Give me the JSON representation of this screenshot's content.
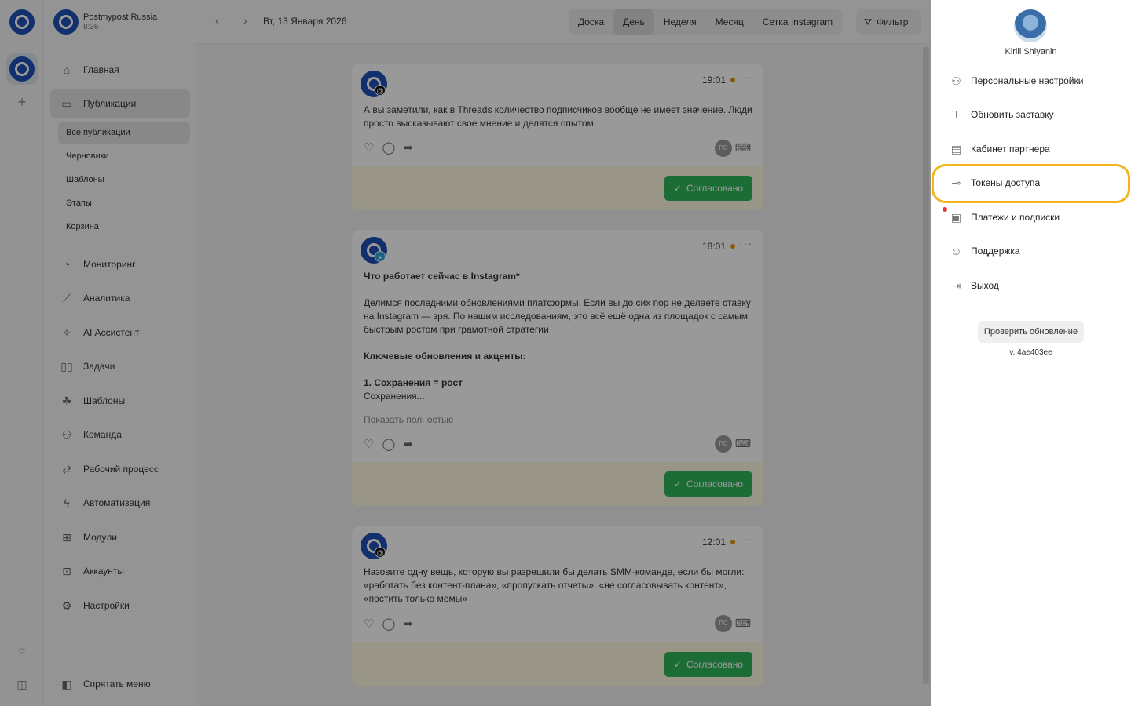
{
  "workspace": {
    "name": "Postmypost Russia",
    "time": "8:36"
  },
  "sidebar": {
    "items": [
      {
        "label": "Главная",
        "icon": "home-icon"
      },
      {
        "label": "Публикации",
        "icon": "publications-icon"
      },
      {
        "label": "Мониторинг",
        "icon": "monitoring-icon"
      },
      {
        "label": "Аналитика",
        "icon": "analytics-icon"
      },
      {
        "label": "AI Ассистент",
        "icon": "sparkles-icon"
      },
      {
        "label": "Задачи",
        "icon": "tasks-icon"
      },
      {
        "label": "Шаблоны",
        "icon": "templates-icon"
      },
      {
        "label": "Команда",
        "icon": "team-icon"
      },
      {
        "label": "Рабочий процесс",
        "icon": "workflow-icon"
      },
      {
        "label": "Автоматизация",
        "icon": "lightning-icon"
      },
      {
        "label": "Модули",
        "icon": "modules-icon"
      },
      {
        "label": "Аккаунты",
        "icon": "accounts-icon"
      },
      {
        "label": "Настройки",
        "icon": "gear-icon"
      }
    ],
    "subitems": [
      "Все публикации",
      "Черновики",
      "Шаблоны",
      "Этапы",
      "Корзина"
    ],
    "hide_menu": "Спрятать меню"
  },
  "topbar": {
    "date": "Вт, 13 Января 2026",
    "views": [
      "Доска",
      "День",
      "Неделя",
      "Месяц",
      "Сетка Instagram"
    ],
    "active_view": "День",
    "filter": "Фильтр"
  },
  "posts": [
    {
      "time": "19:01",
      "network": "threads",
      "text": "А вы заметили, как в Threads количество подписчиков вообще не имеет значение. Люди просто высказывают свое мнение и делятся опытом",
      "initials": "ПС",
      "status": "Согласовано"
    },
    {
      "time": "18:01",
      "network": "telegram",
      "heading": "Что работает сейчас в Instagram*",
      "paragraph": "Делимся последними обновлениями платформы. Если вы до сих пор не делаете ставку на Instagram — зря. По нашим исследованиям, это всё ещё одна из площадок с самым быстрым ростом при грамотной стратегии",
      "subheading": "Ключевые обновления и акценты:",
      "point": "1. Сохранения = рост",
      "tail": "Сохранения...",
      "show_more": "Показать полностью",
      "initials": "ПС",
      "status": "Согласовано"
    },
    {
      "time": "12:01",
      "network": "threads",
      "text": "Назовите одну вещь, которую вы разрешили бы делать SMM-команде, если бы могли: «работать без контент-плана», «пропускать отчеты», «не согласовывать контент», «постить только мемы»",
      "initials": "ПС",
      "status": "Согласовано"
    }
  ],
  "user_menu": {
    "user_name": "Kirill Shlyanin",
    "items": [
      {
        "label": "Персональные настройки",
        "icon": "user-icon"
      },
      {
        "label": "Обновить заставку",
        "icon": "paint-roller-icon"
      },
      {
        "label": "Кабинет партнера",
        "icon": "partner-icon"
      },
      {
        "label": "Токены доступа",
        "icon": "key-icon"
      },
      {
        "label": "Платежи и подписки",
        "icon": "receipt-icon"
      },
      {
        "label": "Поддержка",
        "icon": "chat-smile-icon"
      },
      {
        "label": "Выход",
        "icon": "logout-icon"
      }
    ],
    "highlighted_item": "Токены доступа",
    "check_update": "Проверить обновление",
    "version": "v. 4ae403ee"
  },
  "colors": {
    "brand": "#1e4fb8",
    "approved": "#2fb55b",
    "highlight": "#f2b31b",
    "notification": "#ee3333"
  }
}
